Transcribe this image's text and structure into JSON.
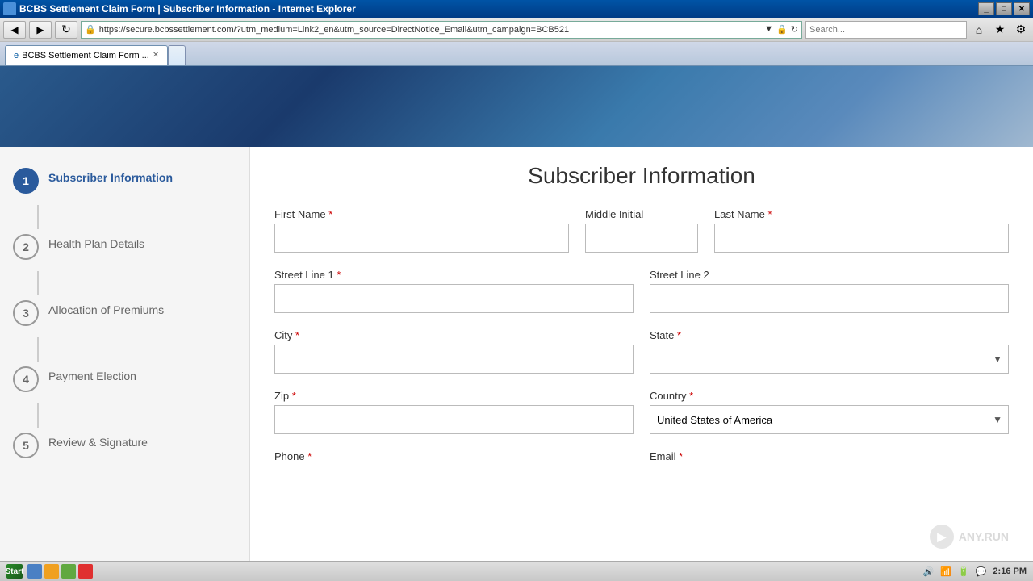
{
  "window": {
    "title": "BCBS Settlement Claim Form | Subscriber Information - Internet Explorer"
  },
  "browser": {
    "back_btn": "◀",
    "forward_btn": "▶",
    "refresh_btn": "↻",
    "url": "https://secure.bcbssettlement.com/?utm_medium=Link2_en&utm_source=DirectNotice_Email&utm_campaign=BCB521",
    "search_placeholder": "Search...",
    "home_btn": "⌂",
    "star_btn": "★",
    "gear_btn": "⚙"
  },
  "tabs": [
    {
      "label": "BCBS Settlement Claim Form ...",
      "active": true
    },
    {
      "label": "",
      "active": false
    }
  ],
  "sidebar": {
    "steps": [
      {
        "number": "1",
        "label": "Subscriber Information",
        "active": true
      },
      {
        "number": "2",
        "label": "Health Plan Details",
        "active": false
      },
      {
        "number": "3",
        "label": "Allocation of Premiums",
        "active": false
      },
      {
        "number": "4",
        "label": "Payment Election",
        "active": false
      },
      {
        "number": "5",
        "label": "Review & Signature",
        "active": false
      }
    ]
  },
  "form": {
    "title": "Subscriber Information",
    "fields": {
      "first_name_label": "First Name",
      "first_name_required": "*",
      "middle_initial_label": "Middle Initial",
      "last_name_label": "Last Name",
      "last_name_required": "*",
      "street1_label": "Street Line 1",
      "street1_required": "*",
      "street2_label": "Street Line 2",
      "city_label": "City",
      "city_required": "*",
      "state_label": "State",
      "state_required": "*",
      "zip_label": "Zip",
      "zip_required": "*",
      "country_label": "Country",
      "country_required": "*",
      "country_value": "United States of America",
      "phone_label": "Phone",
      "phone_required": "*",
      "email_label": "Email",
      "email_required": "*"
    }
  },
  "status_bar": {
    "time": "2:16 PM",
    "start_label": "Start"
  },
  "watermark": {
    "text": "ANY.RUN"
  }
}
